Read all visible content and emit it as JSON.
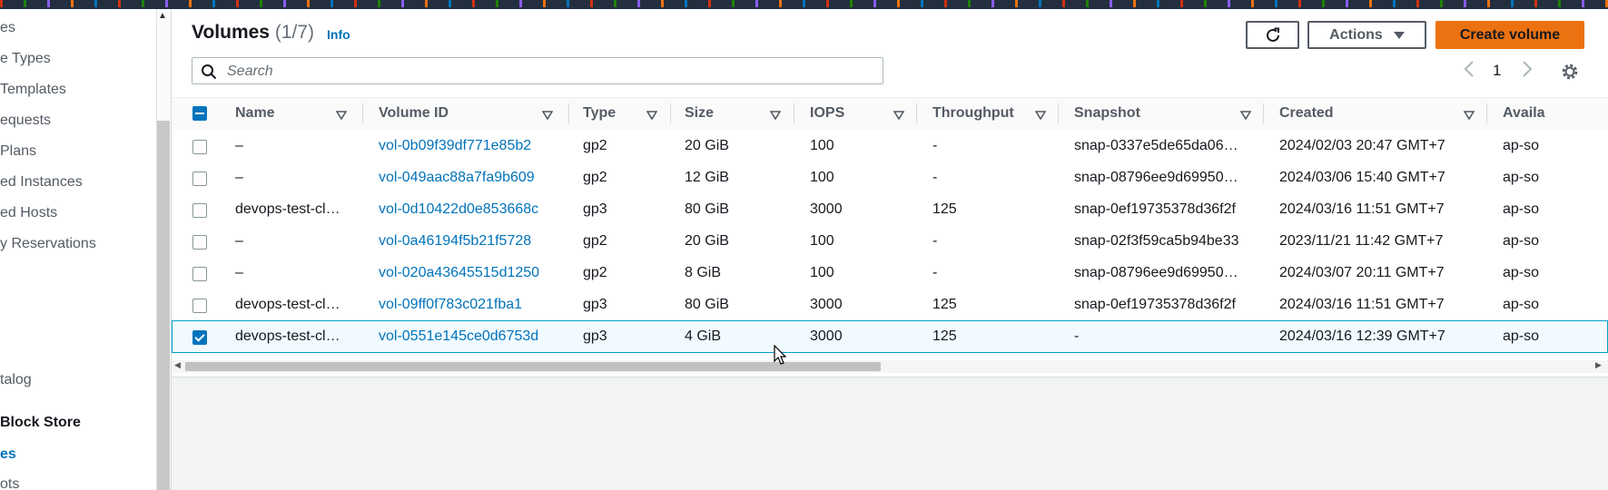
{
  "sidebar": {
    "items": [
      {
        "label": "es",
        "type": "link"
      },
      {
        "label": "e Types",
        "type": "link"
      },
      {
        "label": "Templates",
        "type": "link"
      },
      {
        "label": "equests",
        "type": "link"
      },
      {
        "label": "Plans",
        "type": "link"
      },
      {
        "label": "ed Instances",
        "type": "link"
      },
      {
        "label": "ed Hosts",
        "type": "link"
      },
      {
        "label": "y Reservations",
        "type": "link"
      },
      {
        "label": "talog",
        "type": "link"
      },
      {
        "label": "Block Store",
        "type": "heading"
      },
      {
        "label": "es",
        "type": "active"
      },
      {
        "label": "ots",
        "type": "link"
      }
    ]
  },
  "header": {
    "title": "Volumes",
    "count": "(1/7)",
    "info_label": "Info",
    "actions_label": "Actions",
    "create_label": "Create volume"
  },
  "search": {
    "placeholder": "Search",
    "value": ""
  },
  "pagination": {
    "current_page": "1"
  },
  "table": {
    "columns": [
      "Name",
      "Volume ID",
      "Type",
      "Size",
      "IOPS",
      "Throughput",
      "Snapshot",
      "Created",
      "Availa"
    ],
    "rows": [
      {
        "name": "–",
        "volume_id": "vol-0b09f39df771e85b2",
        "type": "gp2",
        "size": "20 GiB",
        "iops": "100",
        "throughput": "-",
        "snapshot": "snap-0337e5de65da06…",
        "created": "2024/02/03 20:47 GMT+7",
        "az": "ap-so",
        "selected": false
      },
      {
        "name": "–",
        "volume_id": "vol-049aac88a7fa9b609",
        "type": "gp2",
        "size": "12 GiB",
        "iops": "100",
        "throughput": "-",
        "snapshot": "snap-08796ee9d69950…",
        "created": "2024/03/06 15:40 GMT+7",
        "az": "ap-so",
        "selected": false
      },
      {
        "name": "devops-test-cl…",
        "volume_id": "vol-0d10422d0e853668c",
        "type": "gp3",
        "size": "80 GiB",
        "iops": "3000",
        "throughput": "125",
        "snapshot": "snap-0ef19735378d36f2f",
        "created": "2024/03/16 11:51 GMT+7",
        "az": "ap-so",
        "selected": false
      },
      {
        "name": "–",
        "volume_id": "vol-0a46194f5b21f5728",
        "type": "gp2",
        "size": "20 GiB",
        "iops": "100",
        "throughput": "-",
        "snapshot": "snap-02f3f59ca5b94be33",
        "created": "2023/11/21 11:42 GMT+7",
        "az": "ap-so",
        "selected": false
      },
      {
        "name": "–",
        "volume_id": "vol-020a43645515d1250",
        "type": "gp2",
        "size": "8 GiB",
        "iops": "100",
        "throughput": "-",
        "snapshot": "snap-08796ee9d69950…",
        "created": "2024/03/07 20:11 GMT+7",
        "az": "ap-so",
        "selected": false
      },
      {
        "name": "devops-test-cl…",
        "volume_id": "vol-09ff0f783c021fba1",
        "type": "gp3",
        "size": "80 GiB",
        "iops": "3000",
        "throughput": "125",
        "snapshot": "snap-0ef19735378d36f2f",
        "created": "2024/03/16 11:51 GMT+7",
        "az": "ap-so",
        "selected": false
      },
      {
        "name": "devops-test-cl…",
        "volume_id": "vol-0551e145ce0d6753d",
        "type": "gp3",
        "size": "4 GiB",
        "iops": "3000",
        "throughput": "125",
        "snapshot": "-",
        "created": "2024/03/16 12:39 GMT+7",
        "az": "ap-so",
        "selected": true
      }
    ]
  },
  "colors": {
    "accent": "#0073bb",
    "primary_button": "#ec7211",
    "nav_bar": "#232f3e"
  },
  "icons": [
    "refresh-icon",
    "caret-down-icon",
    "search-icon",
    "chevron-left-icon",
    "chevron-right-icon",
    "gear-icon",
    "filter-icon",
    "mouse-pointer-icon"
  ]
}
